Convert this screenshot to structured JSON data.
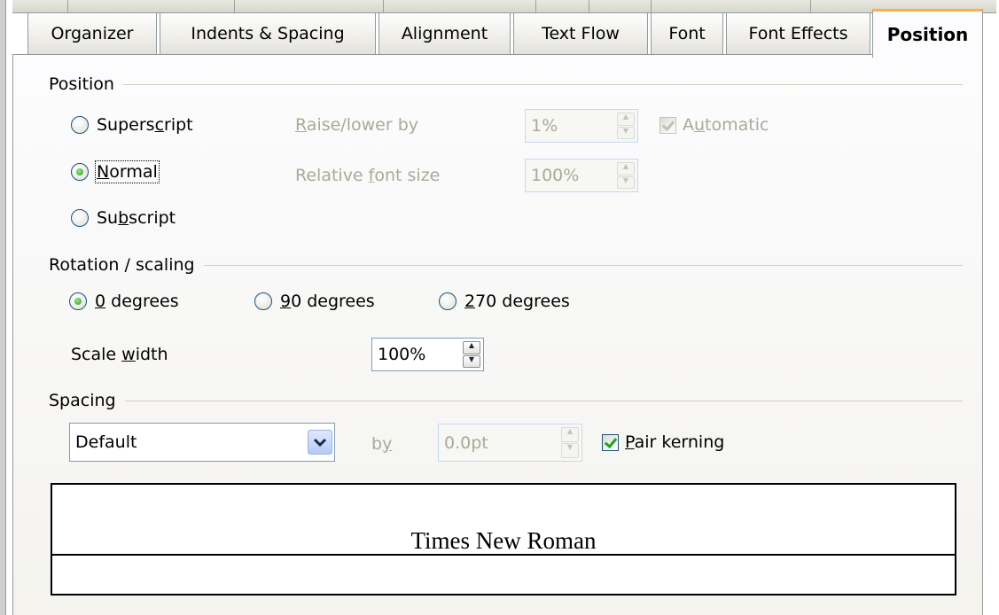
{
  "tabs": [
    {
      "label": "Organizer",
      "active": false
    },
    {
      "label": "Indents & Spacing",
      "active": false
    },
    {
      "label": "Alignment",
      "active": false
    },
    {
      "label": "Text Flow",
      "active": false
    },
    {
      "label": "Font",
      "active": false
    },
    {
      "label": "Font Effects",
      "active": false
    },
    {
      "label": "Position",
      "active": true
    }
  ],
  "position": {
    "section_label": "Position",
    "superscript_label": "Superscript",
    "normal_label": "Normal",
    "subscript_label": "Subscript",
    "selected": "Normal",
    "raise_lower_label": "Raise/lower by",
    "raise_lower_value": "1%",
    "automatic_label": "Automatic",
    "automatic_checked": true,
    "relative_font_size_label": "Relative font size",
    "relative_font_size_value": "100%"
  },
  "rotation": {
    "section_label": "Rotation / scaling",
    "options": [
      "0 degrees",
      "90 degrees",
      "270 degrees"
    ],
    "selected": "0 degrees",
    "scale_width_label": "Scale width",
    "scale_width_value": "100%"
  },
  "spacing": {
    "section_label": "Spacing",
    "select_value": "Default",
    "by_label": "by",
    "by_value": "0.0pt",
    "pair_kerning_label": "Pair kerning",
    "pair_kerning_checked": true
  },
  "preview": {
    "text": "Times New Roman"
  },
  "colors": {
    "active_tab_accent": "#f7b24a",
    "radio_dot": "#21a121",
    "checkmark": "#21a121",
    "disabled_text": "#aca899"
  }
}
